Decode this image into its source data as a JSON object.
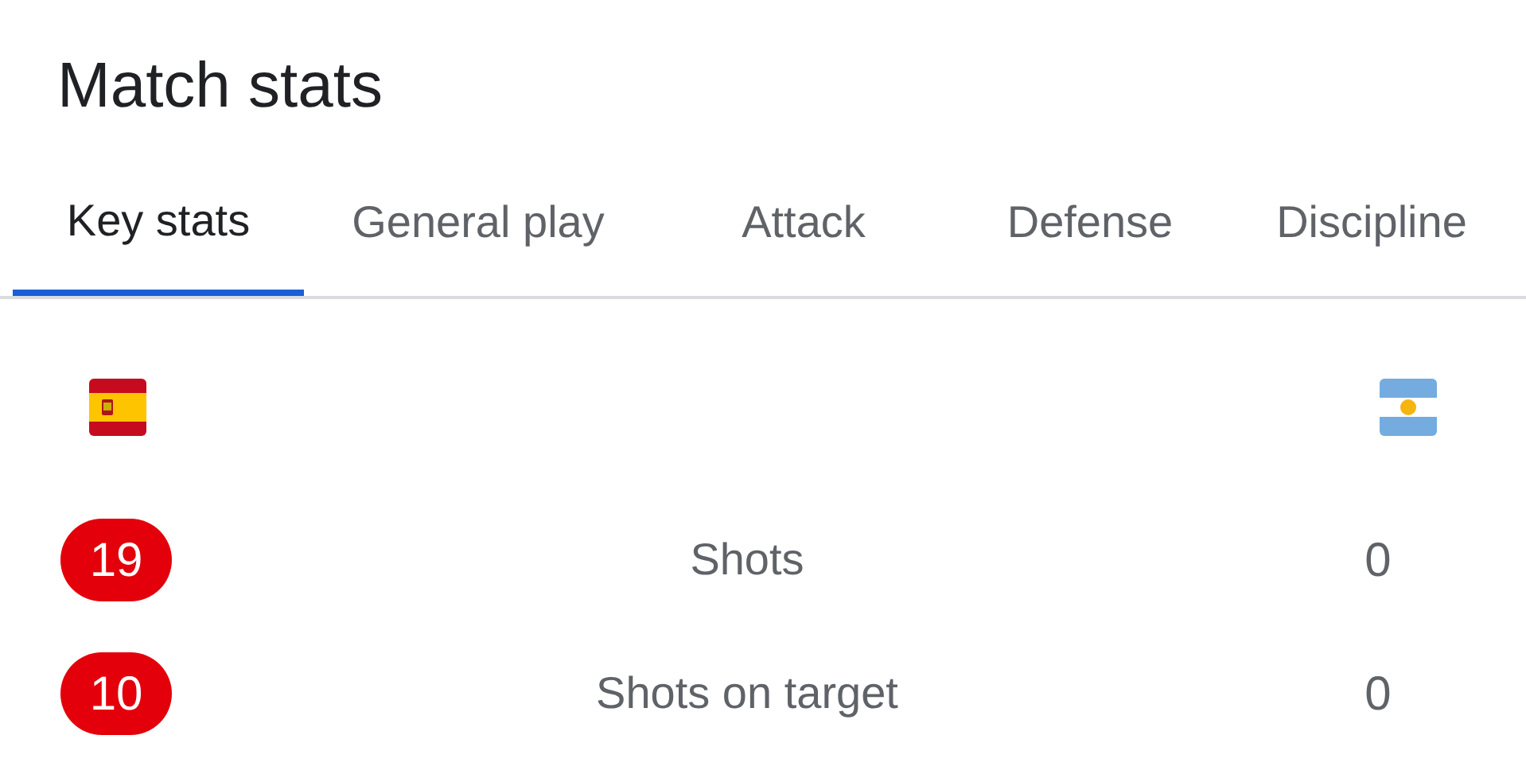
{
  "title": "Match stats",
  "tabs": [
    {
      "label": "Key stats",
      "selected": true
    },
    {
      "label": "General play",
      "selected": false
    },
    {
      "label": "Attack",
      "selected": false
    },
    {
      "label": "Defense",
      "selected": false
    },
    {
      "label": "Discipline",
      "selected": false
    }
  ],
  "teams": [
    {
      "kind": "spain"
    },
    {
      "kind": "argentina"
    }
  ],
  "stats": [
    {
      "label": "Shots",
      "home": "19",
      "away": "0",
      "home_leads": true,
      "away_leads": false
    },
    {
      "label": "Shots on target",
      "home": "10",
      "away": "0",
      "home_leads": true,
      "away_leads": false
    }
  ]
}
